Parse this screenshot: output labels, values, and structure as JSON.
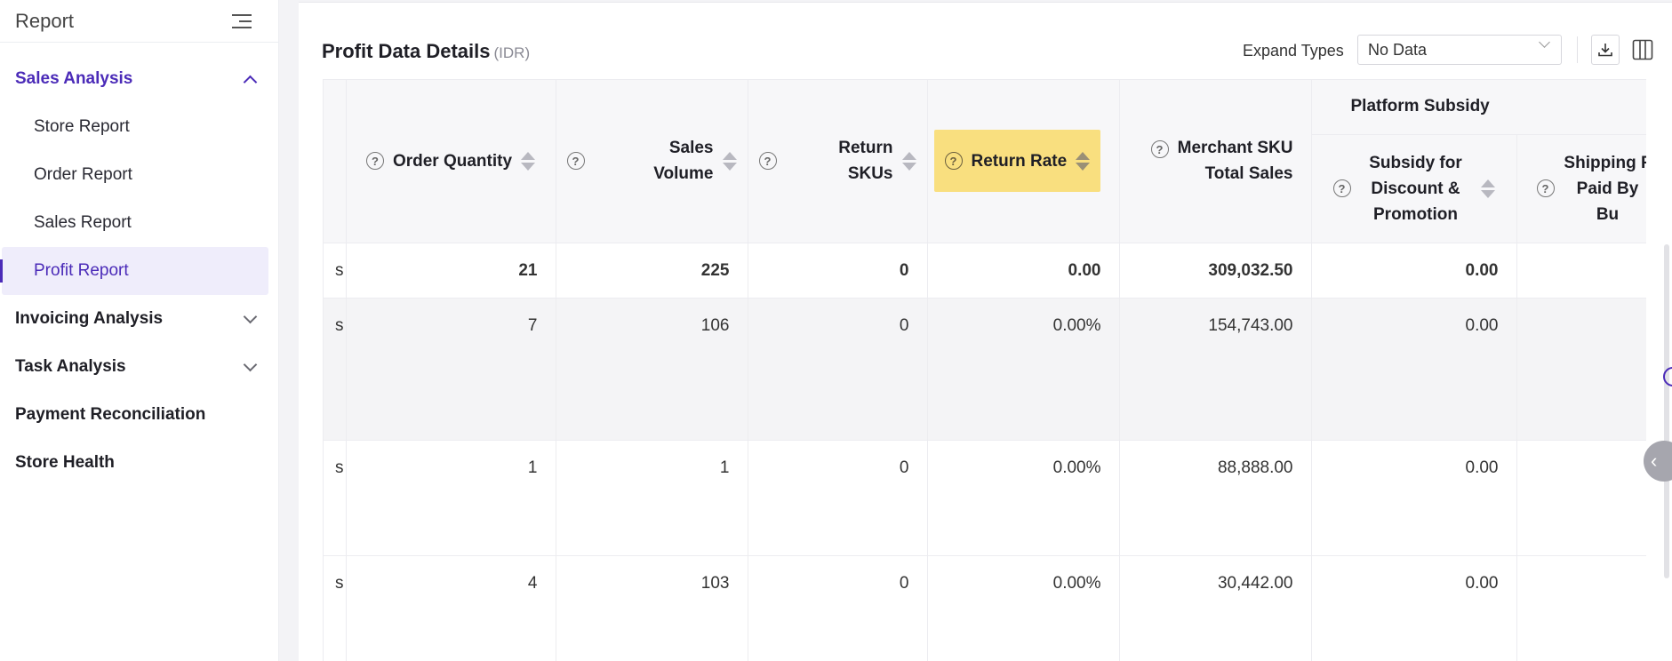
{
  "sidebar": {
    "title": "Report",
    "groups": [
      {
        "label": "Sales Analysis",
        "expanded": true,
        "items": [
          {
            "label": "Store Report"
          },
          {
            "label": "Order Report"
          },
          {
            "label": "Sales Report"
          },
          {
            "label": "Profit Report",
            "active": true
          }
        ]
      },
      {
        "label": "Invoicing Analysis",
        "expanded": false
      },
      {
        "label": "Task Analysis",
        "expanded": false
      },
      {
        "label": "Payment Reconciliation"
      },
      {
        "label": "Store Health"
      }
    ]
  },
  "main": {
    "title": "Profit Data Details",
    "currency": "(IDR)",
    "expand_label": "Expand Types",
    "expand_value": "No Data"
  },
  "table": {
    "headers": {
      "order_quantity": "Order Quantity",
      "sales_volume": "Sales Volume",
      "return_skus": "Return SKUs",
      "return_rate": "Return Rate",
      "merchant_sku": "Merchant SKU Total Sales",
      "platform_subsidy": "Platform Subsidy",
      "subsidy_discount": "Subsidy for Discount & Promotion",
      "shipping": "Shipping F Paid By Bu"
    },
    "rows": [
      {
        "cut": "s",
        "order_quantity": "21",
        "sales_volume": "225",
        "return_skus": "0",
        "return_rate": "0.00",
        "merchant_sku": "309,032.50",
        "subsidy": "0.00"
      },
      {
        "cut": "s",
        "order_quantity": "7",
        "sales_volume": "106",
        "return_skus": "0",
        "return_rate": "0.00%",
        "merchant_sku": "154,743.00",
        "subsidy": "0.00"
      },
      {
        "cut": "s",
        "order_quantity": "1",
        "sales_volume": "1",
        "return_skus": "0",
        "return_rate": "0.00%",
        "merchant_sku": "88,888.00",
        "subsidy": "0.00"
      },
      {
        "cut": "s",
        "order_quantity": "4",
        "sales_volume": "103",
        "return_skus": "0",
        "return_rate": "0.00%",
        "merchant_sku": "30,442.00",
        "subsidy": "0.00"
      }
    ]
  },
  "colors": {
    "accent": "#4b2bb8",
    "highlight": "#f9df7f"
  }
}
